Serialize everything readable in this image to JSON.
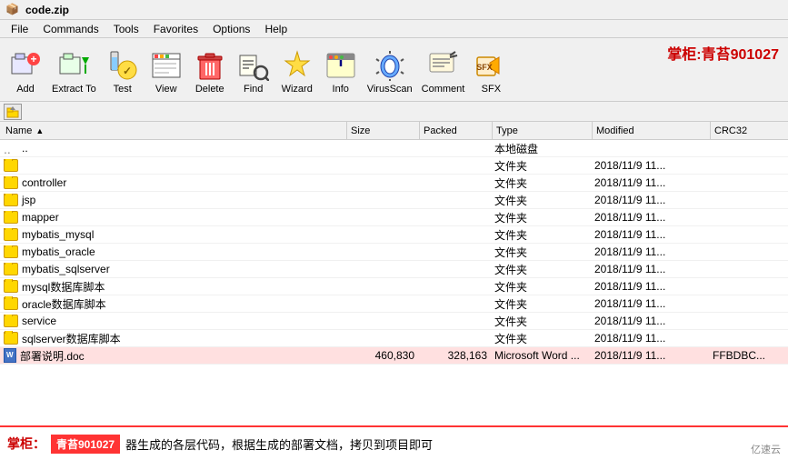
{
  "titleBar": {
    "icon": "📦",
    "title": "code.zip"
  },
  "menuBar": {
    "items": [
      "File",
      "Commands",
      "Tools",
      "Favorites",
      "Options",
      "Help"
    ]
  },
  "toolbar": {
    "buttons": [
      {
        "label": "Add",
        "icon": "➕"
      },
      {
        "label": "Extract To",
        "icon": "📤"
      },
      {
        "label": "Test",
        "icon": "🔬"
      },
      {
        "label": "View",
        "icon": "👁"
      },
      {
        "label": "Delete",
        "icon": "🗑"
      },
      {
        "label": "Find",
        "icon": "🔍"
      },
      {
        "label": "Wizard",
        "icon": "🧙"
      },
      {
        "label": "Info",
        "icon": "ℹ"
      },
      {
        "label": "VirusScan",
        "icon": "🛡"
      },
      {
        "label": "Comment",
        "icon": "✏"
      },
      {
        "label": "SFX",
        "icon": "📦"
      }
    ],
    "watermark": "掌柜:青苔901027"
  },
  "nav": {
    "upButtonTitle": "Up one level"
  },
  "fileList": {
    "columns": [
      "Name",
      "Size",
      "Packed",
      "Type",
      "Modified",
      "CRC32"
    ],
    "rows": [
      {
        "name": "..",
        "size": "",
        "packed": "",
        "type": "本地磁盘",
        "modified": "",
        "crc32": "",
        "icon": "parent"
      },
      {
        "name": "",
        "size": "",
        "packed": "",
        "type": "文件夹",
        "modified": "2018/11/9 11...",
        "crc32": "",
        "icon": "folder"
      },
      {
        "name": "controller",
        "size": "",
        "packed": "",
        "type": "文件夹",
        "modified": "2018/11/9 11...",
        "crc32": "",
        "icon": "folder"
      },
      {
        "name": "jsp",
        "size": "",
        "packed": "",
        "type": "文件夹",
        "modified": "2018/11/9 11...",
        "crc32": "",
        "icon": "folder"
      },
      {
        "name": "mapper",
        "size": "",
        "packed": "",
        "type": "文件夹",
        "modified": "2018/11/9 11...",
        "crc32": "",
        "icon": "folder"
      },
      {
        "name": "mybatis_mysql",
        "size": "",
        "packed": "",
        "type": "文件夹",
        "modified": "2018/11/9 11...",
        "crc32": "",
        "icon": "folder"
      },
      {
        "name": "mybatis_oracle",
        "size": "",
        "packed": "",
        "type": "文件夹",
        "modified": "2018/11/9 11...",
        "crc32": "",
        "icon": "folder"
      },
      {
        "name": "mybatis_sqlserver",
        "size": "",
        "packed": "",
        "type": "文件夹",
        "modified": "2018/11/9 11...",
        "crc32": "",
        "icon": "folder"
      },
      {
        "name": "mysql数据库脚本",
        "size": "",
        "packed": "",
        "type": "文件夹",
        "modified": "2018/11/9 11...",
        "crc32": "",
        "icon": "folder"
      },
      {
        "name": "oracle数据库脚本",
        "size": "",
        "packed": "",
        "type": "文件夹",
        "modified": "2018/11/9 11...",
        "crc32": "",
        "icon": "folder"
      },
      {
        "name": "service",
        "size": "",
        "packed": "",
        "type": "文件夹",
        "modified": "2018/11/9 11...",
        "crc32": "",
        "icon": "folder"
      },
      {
        "name": "sqlserver数据库脚本",
        "size": "",
        "packed": "",
        "type": "文件夹",
        "modified": "2018/11/9 11...",
        "crc32": "",
        "icon": "folder"
      },
      {
        "name": "部署说明.doc",
        "size": "460,830",
        "packed": "328,163",
        "type": "Microsoft Word ...",
        "modified": "2018/11/9 11...",
        "crc32": "FFBDBC...",
        "icon": "doc"
      }
    ]
  },
  "bottomBanner": {
    "label": "掌柜：",
    "highlight": "青苔901027",
    "text": "器生成的各层代码，根据生成的部署文档，拷贝到项目即可"
  },
  "watermarkBottom": "亿速云"
}
